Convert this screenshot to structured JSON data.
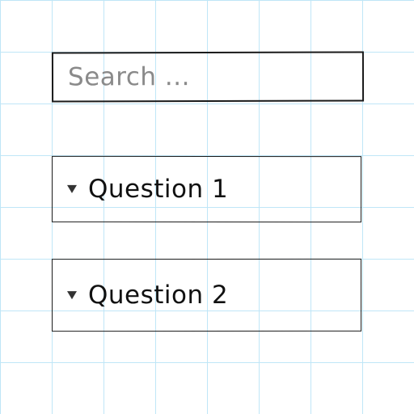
{
  "search": {
    "placeholder": "Search ..."
  },
  "questions": [
    {
      "label": "Question 1",
      "icon": "caret-down-icon"
    },
    {
      "label": "Question 2",
      "icon": "caret-down-icon"
    }
  ],
  "colors": {
    "grid": "#bfe6f7",
    "border": "#1a1a1a",
    "placeholder": "#8a8a8a",
    "text": "#111111"
  }
}
